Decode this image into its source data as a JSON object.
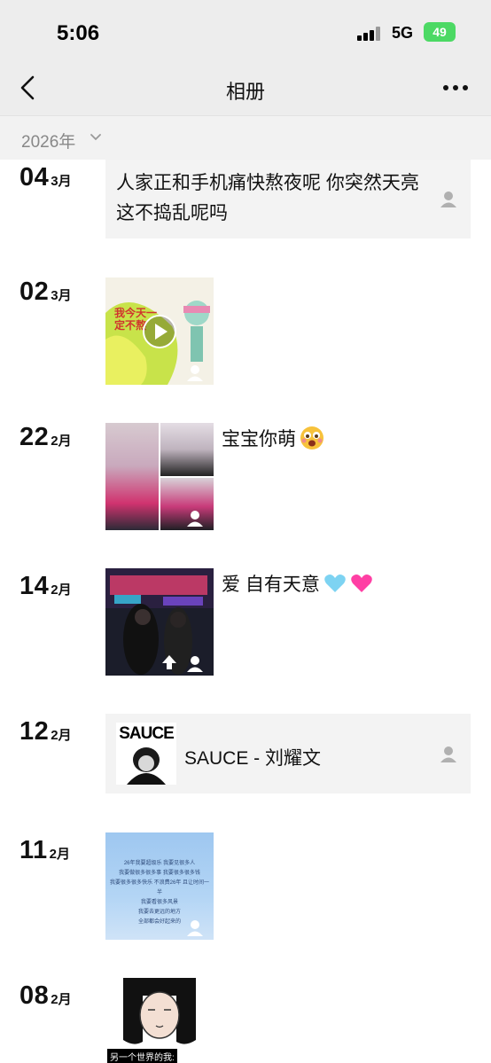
{
  "status": {
    "time": "5:06",
    "network": "5G",
    "battery": "49"
  },
  "nav": {
    "title": "相册",
    "back_icon": "chevron-left-icon",
    "more_icon": "more-icon"
  },
  "year": {
    "label": "2026年",
    "icon": "chevron-down-icon"
  },
  "entries": [
    {
      "day": "04",
      "month": "3月",
      "type": "text",
      "text": "人家正和手机痛快熬夜呢 你突然天亮这不捣乱呢吗"
    },
    {
      "day": "02",
      "month": "3月",
      "type": "video",
      "thumb_text": "我今天一定不熬"
    },
    {
      "day": "22",
      "month": "2月",
      "type": "photos",
      "caption": "宝宝你萌",
      "caption_emoji": "surprised-face-emoji"
    },
    {
      "day": "14",
      "month": "2月",
      "type": "photo",
      "caption": "爱 自有天意",
      "caption_emojis": [
        "light-blue-heart-emoji",
        "pink-heart-emoji"
      ]
    },
    {
      "day": "12",
      "month": "2月",
      "type": "music",
      "cover_text": "SAUCE",
      "title": "SAUCE - 刘耀文"
    },
    {
      "day": "11",
      "month": "2月",
      "type": "photo",
      "thumb_lines": [
        "26年我要超级乐 我要见很多人",
        "我要做很多很多事 我要很多很多钱",
        "我要很多很多快乐 不浪费26年 且让时间一半",
        "我要看很多风景",
        "我要去更远的地方",
        "全部都会好起来的"
      ]
    },
    {
      "day": "08",
      "month": "2月",
      "type": "photo",
      "thumb_caption": "另一个世界的我:"
    }
  ],
  "colors": {
    "header_bg": "#ededed",
    "card_bg": "#f3f3f3",
    "battery": "#4cd964"
  }
}
